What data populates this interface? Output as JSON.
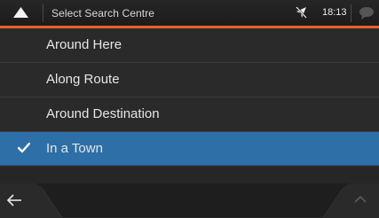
{
  "header": {
    "title": "Select Search Centre",
    "time": "18:13",
    "up_icon": "triangle-up-icon",
    "gps_icon": "gps-off-icon",
    "message_icon": "speech-bubble-icon",
    "accent_color": "#e9602a"
  },
  "menu": {
    "items": [
      {
        "label": "Around Here",
        "selected": false
      },
      {
        "label": "Along Route",
        "selected": false
      },
      {
        "label": "Around Destination",
        "selected": false
      },
      {
        "label": "In a Town",
        "selected": true
      }
    ],
    "selected_color": "#2d6fa6"
  },
  "footer": {
    "back_icon": "arrow-left-icon",
    "scroll_icon": "chevron-up-icon"
  }
}
